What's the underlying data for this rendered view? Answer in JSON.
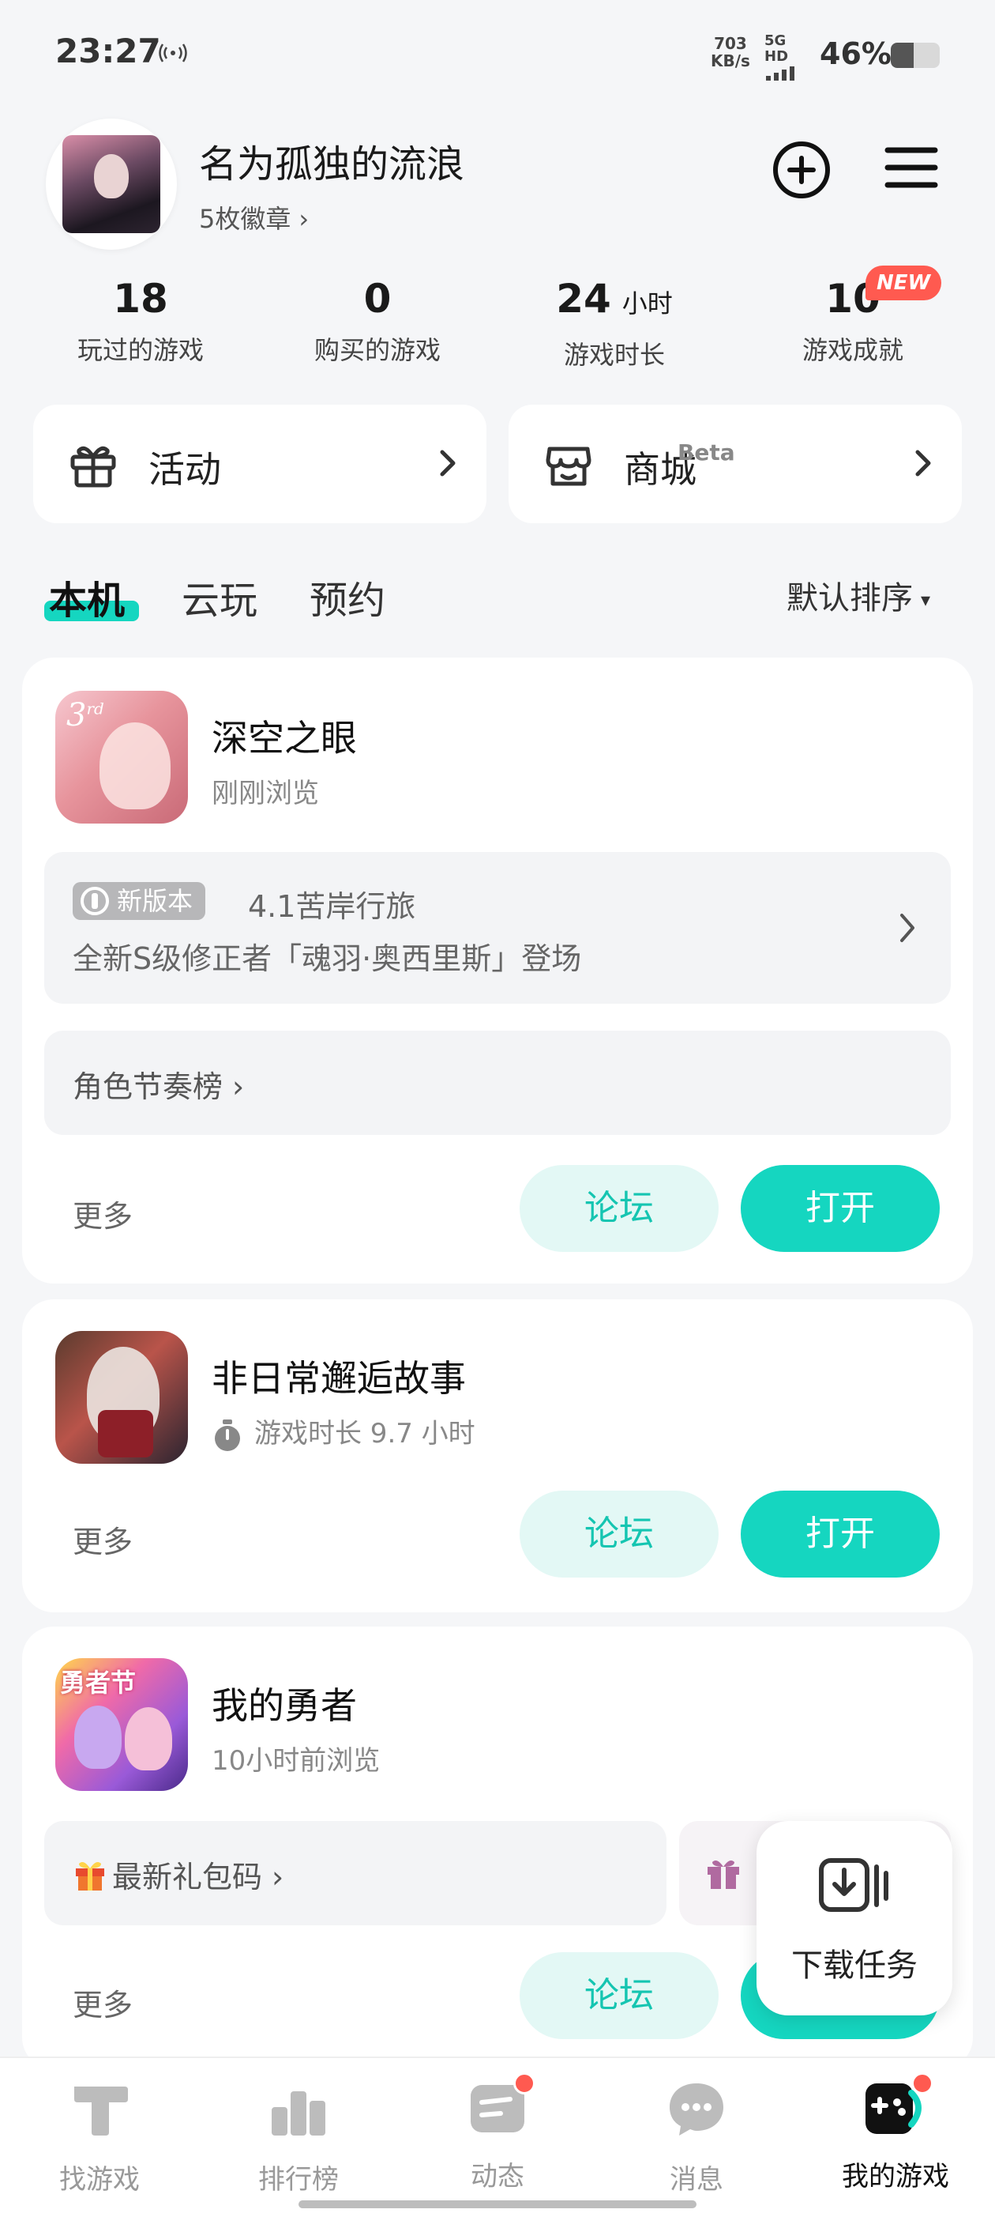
{
  "status_bar": {
    "time": "23:27",
    "net_speed_value": "703",
    "net_speed_unit": "KB/s",
    "signal_label": "5G HD",
    "battery_text": "46%",
    "battery_level": 0.46
  },
  "profile": {
    "username": "名为孤独的流浪",
    "badges_label": "5枚徽章",
    "badges_chevron": "›"
  },
  "stats": [
    {
      "value": "18",
      "unit": "",
      "label": "玩过的游戏"
    },
    {
      "value": "0",
      "unit": "",
      "label": "购买的游戏"
    },
    {
      "value": "24",
      "unit": "小时",
      "label": "游戏时长"
    },
    {
      "value": "10",
      "unit": "",
      "label": "游戏成就"
    }
  ],
  "new_badge": "NEW",
  "entries": {
    "activity": {
      "label": "活动",
      "icon": "gift-icon"
    },
    "store": {
      "label": "商城",
      "beta": "Beta",
      "icon": "store-icon"
    }
  },
  "tabs": {
    "local": "本机",
    "cloud": "云玩",
    "reserve": "预约",
    "sort_label": "默认排序",
    "sort_caret": "▾"
  },
  "games": [
    {
      "name": "深空之眼",
      "sub": "刚刚浏览",
      "update_tag": "新版本",
      "update_title": "4.1苦岸行旅",
      "update_desc": "全新S级修正者「魂羽·奥西里斯」登场",
      "extra_link": "角色节奏榜",
      "extra_chevron": "›",
      "more": "更多",
      "forum": "论坛",
      "open": "打开"
    },
    {
      "name": "非日常邂逅故事",
      "sub": "游戏时长 9.7 小时",
      "more": "更多",
      "forum": "论坛",
      "open": "打开"
    },
    {
      "name": "我的勇者",
      "sub": "10小时前浏览",
      "gift_link": "最新礼包码",
      "gift_chevron": "›",
      "more": "更多",
      "forum": "论坛"
    }
  ],
  "float_task": {
    "label": "下载任务"
  },
  "bottom_nav": [
    {
      "label": "找游戏",
      "icon": "find-game-icon"
    },
    {
      "label": "排行榜",
      "icon": "ranking-icon"
    },
    {
      "label": "动态",
      "icon": "feed-icon"
    },
    {
      "label": "消息",
      "icon": "message-icon"
    },
    {
      "label": "我的游戏",
      "icon": "my-games-icon"
    }
  ],
  "colors": {
    "accent": "#15d6c0",
    "accent_light": "#e3f8f5",
    "badge_red": "#ff5a50"
  }
}
